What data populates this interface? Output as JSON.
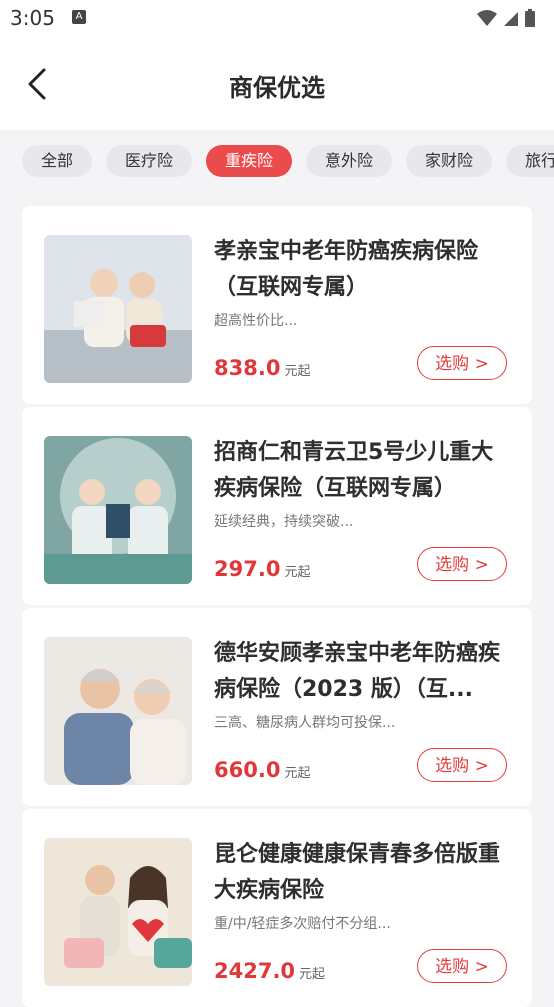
{
  "status": {
    "time": "3:05",
    "a_icon": "A"
  },
  "header": {
    "title": "商保优选"
  },
  "tabs": [
    "全部",
    "医疗险",
    "重疾险",
    "意外险",
    "家财险",
    "旅行"
  ],
  "products": [
    {
      "title": "孝亲宝中老年防癌疾病保险（互联网专属）",
      "subtitle": "超高性价比...",
      "price": "838.0",
      "unit": "元起",
      "button": "选购 >"
    },
    {
      "title": "招商仁和青云卫5号少儿重大疾病保险（互联网专属）",
      "subtitle": "延续经典，持续突破...",
      "price": "297.0",
      "unit": "元起",
      "button": "选购 >"
    },
    {
      "title": "德华安顾孝亲宝中老年防癌疾病保险（2023 版）（互...",
      "subtitle": "三高、糖尿病人群均可投保...",
      "price": "660.0",
      "unit": "元起",
      "button": "选购 >"
    },
    {
      "title": "昆仑健康健康保青春多倍版重大疾病保险",
      "subtitle": "重/中/轻症多次赔付不分组...",
      "price": "2427.0",
      "unit": "元起",
      "button": "选购 >"
    }
  ],
  "colors": {
    "accent": "#ea4b4b",
    "price": "#e0383a"
  }
}
